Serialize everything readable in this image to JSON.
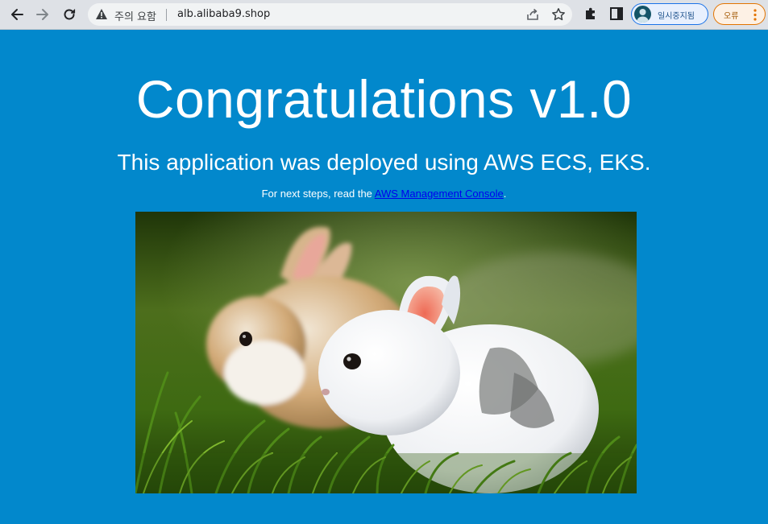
{
  "browser": {
    "security_warning": "주의 요함",
    "url": "alb.alibaba9.shop",
    "profile_label": "일시중지됨",
    "error_label": "오류"
  },
  "page": {
    "headline": "Congratulations v1.0",
    "subheadline": "This application was deployed using AWS ECS, EKS.",
    "next_steps_prefix": "For next steps, read the ",
    "next_steps_link": "AWS Management Console",
    "next_steps_suffix": "."
  },
  "icons": {
    "back": "arrow-left-icon",
    "forward": "arrow-right-icon",
    "reload": "reload-icon",
    "warning": "warning-triangle-icon",
    "share": "share-icon",
    "bookmark": "star-icon",
    "extensions": "puzzle-icon",
    "side_panel": "side-panel-icon",
    "menu": "kebab-menu-icon"
  },
  "colors": {
    "page_background": "#0288cc",
    "link": "#0000ee",
    "profile_accent": "#1a73e8",
    "error_accent": "#e37400"
  }
}
